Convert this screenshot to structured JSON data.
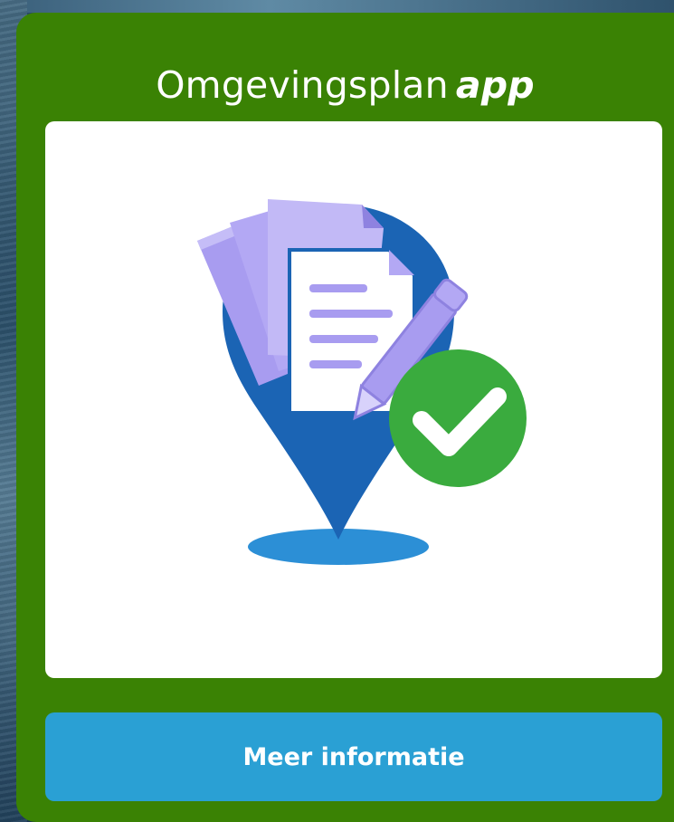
{
  "card": {
    "title_main": "Omgevingsplan",
    "title_emphasis": "app",
    "background_color": "#3a8204",
    "illustration": {
      "icon": "map-pin-documents-pencil-check-icon"
    }
  },
  "actions": {
    "more_info_label": "Meer informatie",
    "more_info_color": "#2aa0d4"
  }
}
